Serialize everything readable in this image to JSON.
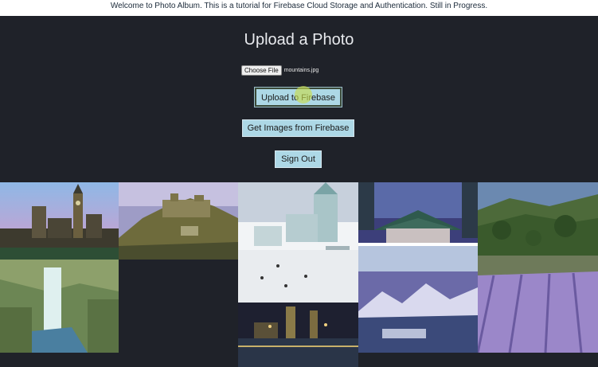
{
  "banner": {
    "text": "Welcome to Photo Album. This is a tutorial for Firebase Cloud Storage and Authentication. Still in Progress."
  },
  "upload": {
    "title": "Upload a Photo",
    "choose_file_label": "Choose File",
    "file_name": "mountains.jpg",
    "upload_button": "Upload to Firebase",
    "get_images_button": "Get Images from Firebase",
    "sign_out_button": "Sign Out"
  },
  "colors": {
    "page_bg": "#1f2229",
    "button_bg": "#add8e6",
    "banner_bg": "#ffffff"
  },
  "gallery": {
    "photos": [
      {
        "name": "city-clock-tower-photo",
        "subject": "city skyline with clock tower"
      },
      {
        "name": "hilltop-fortress-photo",
        "subject": "hilltop fortress"
      },
      {
        "name": "snow-castle-photo",
        "subject": "snow and ice castle"
      },
      {
        "name": "asian-pagoda-photo",
        "subject": "pagoda by the water"
      },
      {
        "name": "green-hills-photo",
        "subject": "green forested hills"
      },
      {
        "name": "waterfall-photo",
        "subject": "waterfall"
      },
      {
        "name": "lavender-field-photo",
        "subject": "lavender field rows"
      },
      {
        "name": "snowy-mountains-photo",
        "subject": "snowy mountains and lake"
      },
      {
        "name": "night-river-city-photo",
        "subject": "city by river at night"
      }
    ]
  }
}
